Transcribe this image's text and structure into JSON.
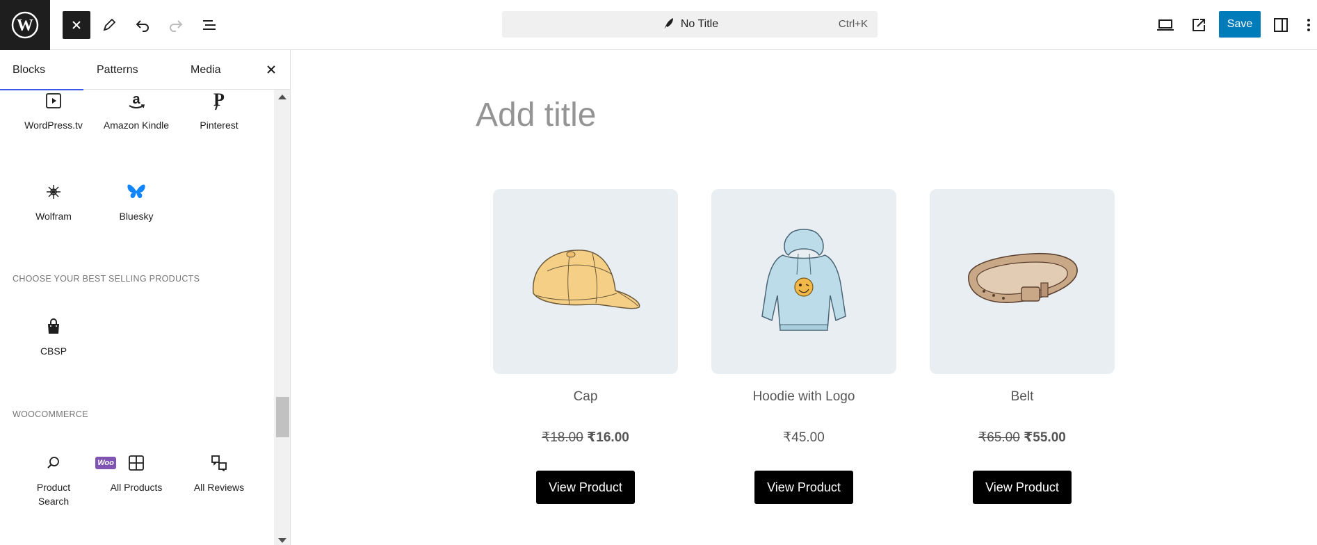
{
  "toolbar": {
    "document_title": "No Title",
    "shortcut": "Ctrl+K",
    "save_label": "Save"
  },
  "sidebar": {
    "tabs": [
      {
        "label": "Blocks",
        "active": true
      },
      {
        "label": "Patterns",
        "active": false
      },
      {
        "label": "Media",
        "active": false
      }
    ],
    "embed_blocks": [
      {
        "label": "WordPress.tv",
        "icon": "video-embed-icon"
      },
      {
        "label": "Amazon Kindle",
        "icon": "amazon-icon"
      },
      {
        "label": "Pinterest",
        "icon": "pinterest-icon"
      },
      {
        "label": "Wolfram",
        "icon": "wolfram-icon"
      },
      {
        "label": "Bluesky",
        "icon": "bluesky-icon"
      }
    ],
    "sections": [
      {
        "title": "CHOOSE YOUR BEST SELLING PRODUCTS",
        "blocks": [
          {
            "label": "CBSP",
            "icon": "shopping-bag-icon"
          }
        ]
      },
      {
        "title": "WOOCOMMERCE",
        "badge": "Woo",
        "blocks": [
          {
            "label": "Product Search",
            "icon": "search-icon"
          },
          {
            "label": "All Products",
            "icon": "grid-icon"
          },
          {
            "label": "All Reviews",
            "icon": "reviews-icon"
          }
        ]
      }
    ]
  },
  "canvas": {
    "title_placeholder": "Add title",
    "products": [
      {
        "name": "Cap",
        "old_price": "₹18.00",
        "price": "₹16.00",
        "button": "View Product"
      },
      {
        "name": "Hoodie with Logo",
        "old_price": "",
        "price": "₹45.00",
        "button": "View Product"
      },
      {
        "name": "Belt",
        "old_price": "₹65.00",
        "price": "₹55.00",
        "button": "View Product"
      }
    ]
  },
  "colors": {
    "accent": "#007cba",
    "tab_indicator": "#3858e9",
    "woo": "#7f54b3",
    "bluesky": "#1185fe"
  }
}
